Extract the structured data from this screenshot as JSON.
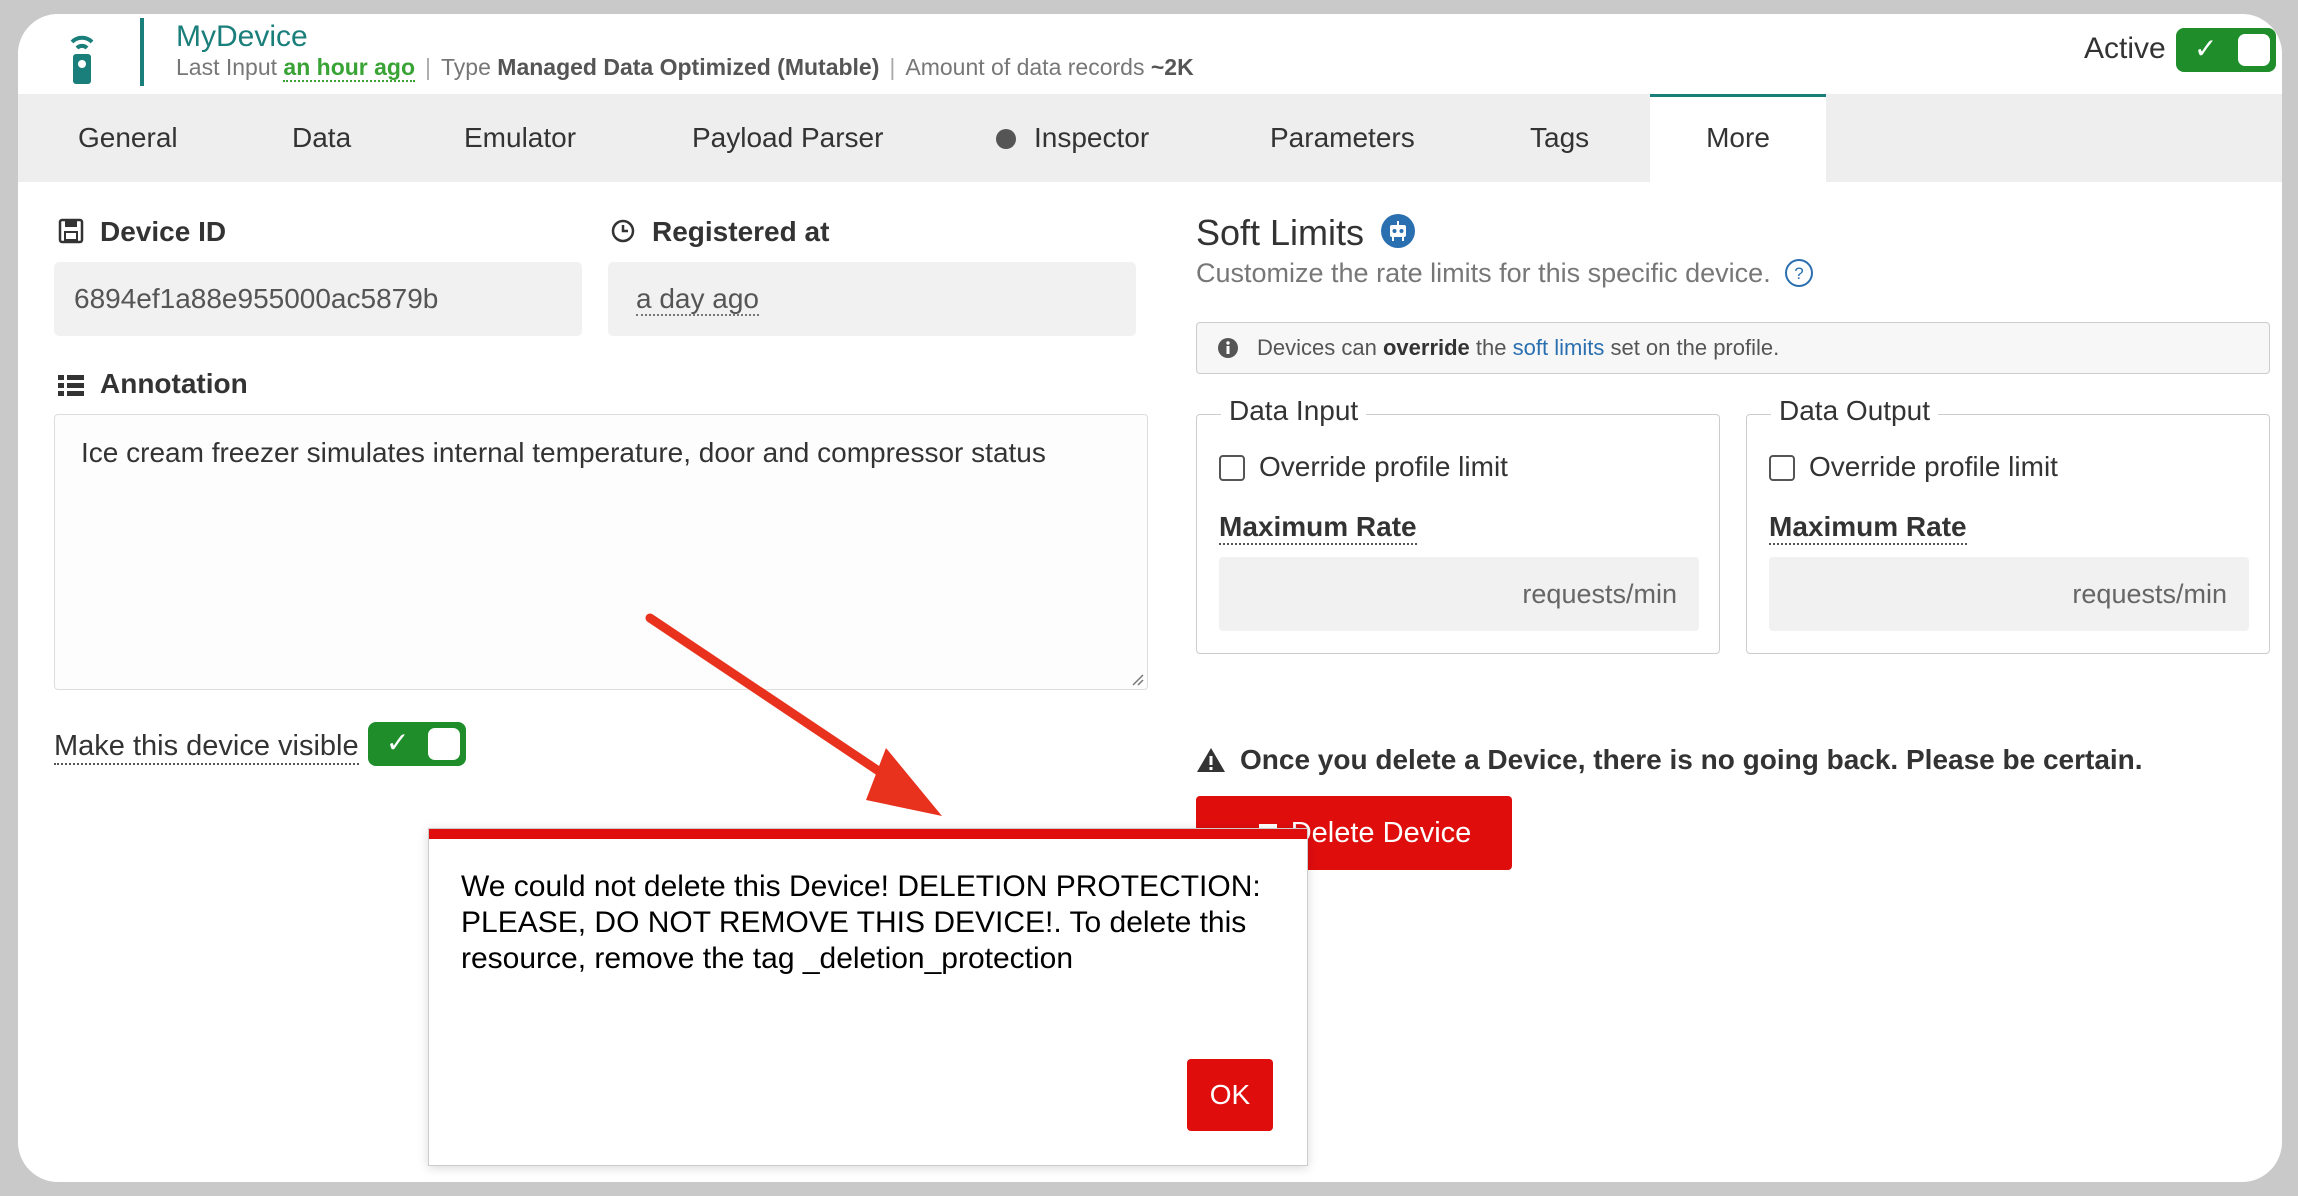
{
  "header": {
    "device_name": "MyDevice",
    "last_input_label": "Last Input",
    "last_input_value": "an hour ago",
    "type_label": "Type",
    "type_value": "Managed Data Optimized (Mutable)",
    "records_label": "Amount of data records",
    "records_value": "~2K",
    "active_label": "Active",
    "active_on": true
  },
  "tabs": [
    "General",
    "Data",
    "Emulator",
    "Payload Parser",
    "Inspector",
    "Parameters",
    "Tags",
    "More"
  ],
  "active_tab": "More",
  "device_id": {
    "label": "Device ID",
    "value": "6894ef1a88e955000ac5879b"
  },
  "registered": {
    "label": "Registered at",
    "value": "a day ago"
  },
  "annotation": {
    "label": "Annotation",
    "value": "Ice cream freezer simulates internal temperature, door and compressor status"
  },
  "visible": {
    "label": "Make this device visible",
    "on": true
  },
  "soft_limits": {
    "title": "Soft Limits",
    "subtitle": "Customize the rate limits for this specific device.",
    "info_pre": "Devices can",
    "info_bold": "override",
    "info_mid": "the",
    "info_link": "soft limits",
    "info_post": "set on the profile.",
    "input": {
      "legend": "Data Input",
      "override_label": "Override profile limit",
      "max_label": "Maximum Rate",
      "unit": "requests/min"
    },
    "output": {
      "legend": "Data Output",
      "override_label": "Override profile limit",
      "max_label": "Maximum Rate",
      "unit": "requests/min"
    }
  },
  "danger": {
    "warning": "Once you delete a Device, there is no going back. Please be certain.",
    "delete_label": "Delete Device"
  },
  "modal": {
    "message": "We could not delete this Device! DELETION PROTECTION: PLEASE, DO NOT REMOVE THIS DEVICE!. To delete this resource, remove the tag _deletion_protection",
    "ok_label": "OK"
  },
  "colors": {
    "brand": "#1a7f7a",
    "toggle_green": "#1e8d2a",
    "danger": "#e00d0d",
    "link": "#2a6fb0"
  },
  "icons": [
    "remote-device-icon",
    "save-icon",
    "clock-icon",
    "list-icon",
    "robot-icon",
    "help-icon",
    "info-icon",
    "warning-icon",
    "trash-icon",
    "check-icon"
  ]
}
